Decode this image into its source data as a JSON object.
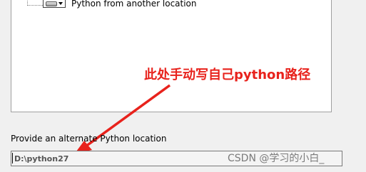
{
  "tree": {
    "item_label": "Python from another location",
    "item_icon": "drive-icon"
  },
  "annotation": {
    "text": "此处手动写自己python路径",
    "color": "#e8221c"
  },
  "field": {
    "label": "Provide an alternate Python location",
    "value": "D:\\python27"
  },
  "watermark": {
    "text": "CSDN @学习的小白_"
  }
}
